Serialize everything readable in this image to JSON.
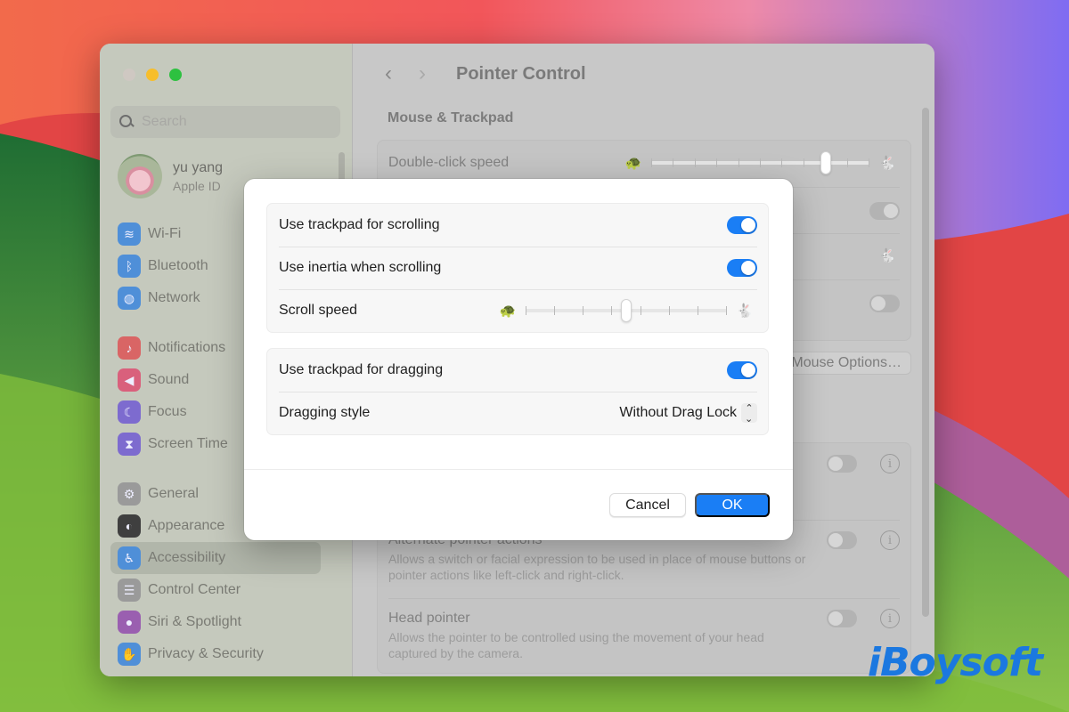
{
  "window": {
    "traffic_lights": [
      "close",
      "minimize",
      "zoom"
    ]
  },
  "sidebar": {
    "search": {
      "placeholder": "Search",
      "value": ""
    },
    "account": {
      "name": "yu yang",
      "subtitle": "Apple ID"
    },
    "groups": [
      [
        {
          "label": "Wi-Fi",
          "icon": "wifi-icon",
          "glyph": "≋",
          "color": "#4f8fd8"
        },
        {
          "label": "Bluetooth",
          "icon": "bluetooth-icon",
          "glyph": "ᛒ",
          "color": "#4f8fd8"
        },
        {
          "label": "Network",
          "icon": "globe-icon",
          "glyph": "◍",
          "color": "#4f8fd8"
        }
      ],
      [
        {
          "label": "Notifications",
          "icon": "bell-icon",
          "glyph": "♪",
          "color": "#d96565"
        },
        {
          "label": "Sound",
          "icon": "speaker-icon",
          "glyph": "◀",
          "color": "#d9607c"
        },
        {
          "label": "Focus",
          "icon": "moon-icon",
          "glyph": "☾",
          "color": "#7d6bcf"
        },
        {
          "label": "Screen Time",
          "icon": "hourglass-icon",
          "glyph": "⧗",
          "color": "#7d6bcf"
        }
      ],
      [
        {
          "label": "General",
          "icon": "gear-icon",
          "glyph": "⚙",
          "color": "#9a9a9a"
        },
        {
          "label": "Appearance",
          "icon": "appearance-icon",
          "glyph": "◐",
          "color": "#3f3f3f"
        },
        {
          "label": "Accessibility",
          "icon": "accessibility-icon",
          "glyph": "♿",
          "color": "#4f8fd8",
          "selected": true
        },
        {
          "label": "Control Center",
          "icon": "control-center-icon",
          "glyph": "☰",
          "color": "#9a9a9a"
        },
        {
          "label": "Siri & Spotlight",
          "icon": "siri-icon",
          "glyph": "●",
          "color": "#9a5fb0"
        },
        {
          "label": "Privacy & Security",
          "icon": "hand-icon",
          "glyph": "✋",
          "color": "#4f8fd8"
        }
      ]
    ]
  },
  "main": {
    "back_label": "‹",
    "forward_label": "›",
    "title": "Pointer Control",
    "section": "Mouse & Trackpad",
    "double_click_label": "Double-click speed",
    "double_click_value": 0.8,
    "mouse_options_label": "Mouse Options…",
    "alternate_title": "Alternate pointer actions",
    "alternate_desc": "Allows a switch or facial expression to be used in place of mouse buttons or pointer actions like left-click and right-click.",
    "head_title": "Head pointer",
    "head_desc": "Allows the pointer to be controlled using the movement of your head captured by the camera.",
    "info_glyph": "i"
  },
  "dialog": {
    "rows_group1": [
      {
        "label": "Use trackpad for scrolling",
        "type": "toggle",
        "on": true
      },
      {
        "label": "Use inertia when scrolling",
        "type": "toggle",
        "on": true
      },
      {
        "label": "Scroll speed",
        "type": "slider",
        "value": 0.5,
        "ticks": 8
      }
    ],
    "drag_label": "Use trackpad for dragging",
    "drag_on": true,
    "style_label": "Dragging style",
    "style_value": "Without Drag Lock",
    "cancel_label": "Cancel",
    "ok_label": "OK",
    "accent": "#1a7ef5"
  },
  "watermark": "iBoysoft"
}
